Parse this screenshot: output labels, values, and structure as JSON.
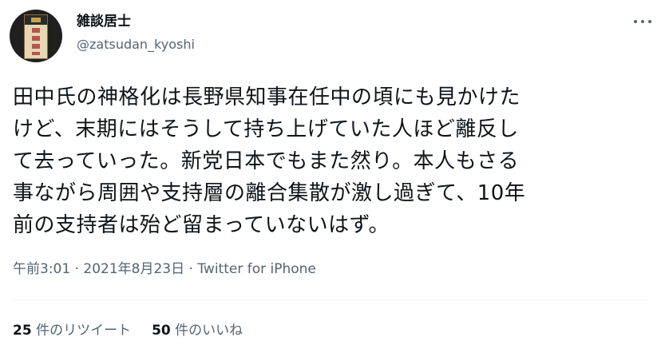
{
  "user": {
    "display_name": "雑談居士",
    "handle": "@zatsudan_kyoshi"
  },
  "tweet": {
    "lines": [
      "田中氏の神格化は長野県知事在任中の頃にも見かけた",
      "けど、末期にはそうして持ち上げていた人ほど離反し",
      "て去っていった。新党日本でもまた然り。本人もさる",
      "事ながら周囲や支持層の離合集散が激し過ぎて、10年",
      "前の支持者は殆ど留まっていないはず。"
    ]
  },
  "meta": {
    "time": "午前3:01",
    "separator": " · ",
    "date": "2021年8月23日",
    "source": "Twitter for iPhone"
  },
  "stats": {
    "retweets_count": "25",
    "retweets_label": " 件のリツイート",
    "likes_count": "50",
    "likes_label": " 件のいいね"
  },
  "icons": {
    "more": "more-horizontal-icon"
  }
}
